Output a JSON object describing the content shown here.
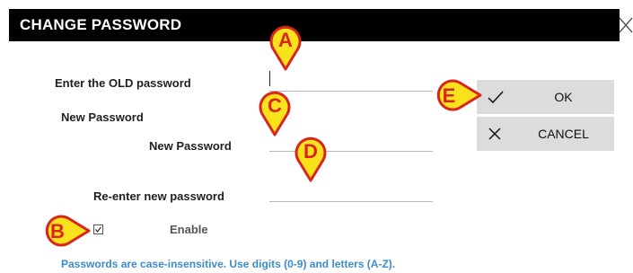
{
  "dialog": {
    "title": "CHANGE PASSWORD",
    "close_icon": "close-icon"
  },
  "form": {
    "old_password_label": "Enter the OLD password",
    "old_password_value": "",
    "new_password_heading": "New Password",
    "new_password_label": "New Password",
    "new_password_value": "",
    "reenter_label": "Re-enter new password",
    "reenter_value": ""
  },
  "buttons": {
    "ok": {
      "label": "OK",
      "icon": "checkmark-icon"
    },
    "cancel": {
      "label": "CANCEL",
      "icon": "x-icon"
    }
  },
  "enable": {
    "label": "Enable",
    "checked": true
  },
  "hint": "Passwords are case-insensitive. Use digits (0-9) and letters (A-Z).",
  "callouts": {
    "a": "A",
    "b": "B",
    "c": "C",
    "d": "D",
    "e": "E"
  },
  "colors": {
    "callout_fill": "#f9e21c",
    "callout_border": "#d9261c",
    "callout_text": "#d9261c",
    "hint_text": "#3d8ccc",
    "button_bg": "#dcdcdc"
  }
}
